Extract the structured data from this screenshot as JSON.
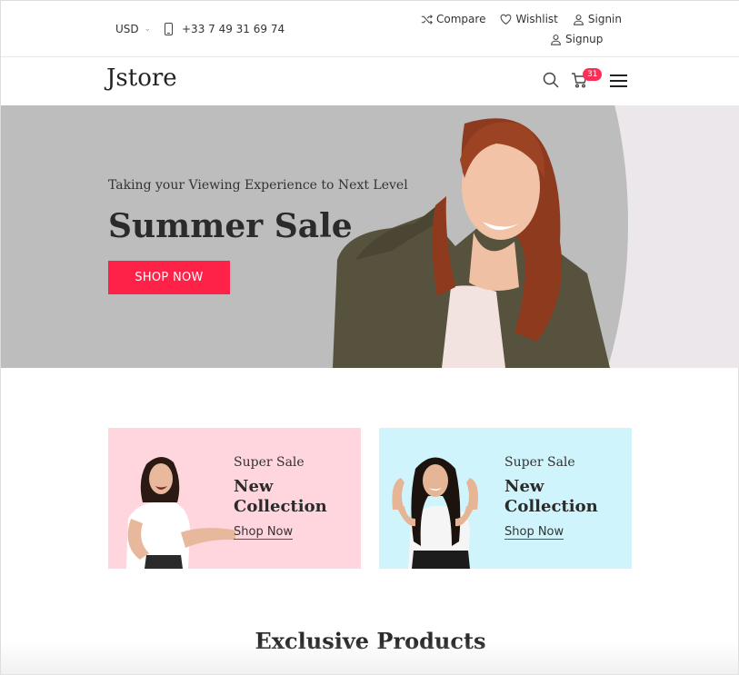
{
  "topbar": {
    "currency": "USD",
    "phone": "+33 7 49 31 69 74",
    "links": {
      "compare": "Compare",
      "wishlist": "Wishlist",
      "signin": "Signin",
      "signup": "Signup"
    }
  },
  "navbar": {
    "logo": "Jstore",
    "cart_count": "31",
    "icons": [
      "search-icon",
      "cart-icon",
      "menu-icon"
    ]
  },
  "hero": {
    "subtitle": "Taking your Viewing Experience to Next Level",
    "title": "Summer Sale",
    "button": "SHOP NOW"
  },
  "banners": [
    {
      "subtitle": "Super Sale",
      "title": "New Collection",
      "link": "Shop Now"
    },
    {
      "subtitle": "Super Sale",
      "title": "New Collection",
      "link": "Shop Now"
    }
  ],
  "section": {
    "title": "Exclusive Products"
  },
  "colors": {
    "accent": "#ff2248",
    "badge": "#ff2d55",
    "pink_banner": "#ffd6de",
    "cyan_banner": "#cff4fb",
    "hero_bg": "#bdbdbd"
  }
}
